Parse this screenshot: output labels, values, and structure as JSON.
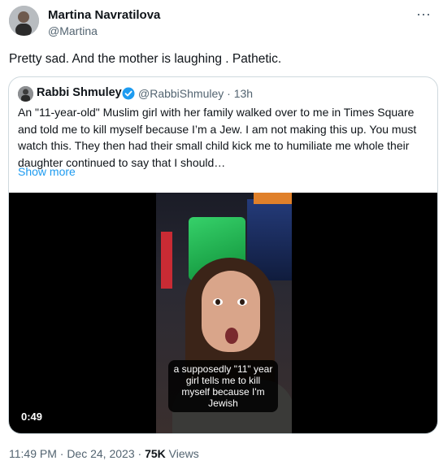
{
  "tweet": {
    "author_name": "Martina Navratilova",
    "author_handle": "@Martina",
    "text": "Pretty sad. And the mother is laughing . Pathetic.",
    "more_icon": "more-horizontal-icon"
  },
  "quoted_tweet": {
    "author_name": "Rabbi Shmuley",
    "verified": true,
    "author_handle_time": "@RabbiShmuley · 13h",
    "text": "An \"11-year-old\" Muslim girl with her family walked over to me in Times Square and told me to kill myself because I’m a Jew. I am not making this up. You must watch this. They then had their small child kick me to humiliate me whole their daughter continued to say that I should…",
    "show_more": "Show more",
    "video": {
      "caption": "a supposedly \"11\" year girl tells me to kill myself because I'm Jewish",
      "duration": "0:49"
    }
  },
  "footer": {
    "timestamp": "11:49 PM · Dec 24, 2023 · ",
    "views_count": "75K",
    "views_label": " Views"
  },
  "colors": {
    "link": "#1d9bf0",
    "muted": "#536471",
    "border": "#cfd9de"
  }
}
